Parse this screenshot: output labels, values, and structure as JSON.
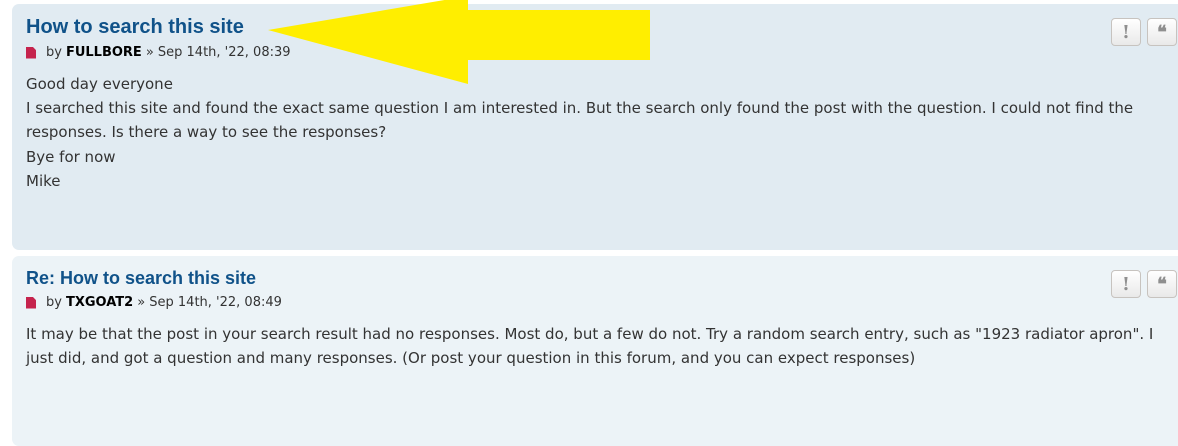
{
  "posts": [
    {
      "title": "How to search this site",
      "by": "by",
      "author": "FULLBORE",
      "date": "» Sep 14th, '22, 08:39",
      "lines": [
        "Good day everyone",
        "I searched this site and found the exact same question I am interested in. But the search only found the post with the question. I could not find the responses. Is there a way to see the responses?",
        "Bye for now",
        "Mike"
      ],
      "report_glyph": "!",
      "quote_glyph": "❝"
    },
    {
      "title": "Re: How to search this site",
      "by": "by",
      "author": "TXGOAT2",
      "date": "» Sep 14th, '22, 08:49",
      "lines": [
        "It may be that the post in your search result had no responses. Most do, but a few do not. Try a random search entry, such as \"1923 radiator apron\". I just did, and got a question and many responses. (Or post your question in this forum, and you can expect responses)"
      ],
      "report_glyph": "!",
      "quote_glyph": "❝"
    }
  ],
  "annotation": {
    "arrow_color": "#ffee00",
    "icon": "arrow-left-icon"
  },
  "colors": {
    "post1_bg": "#e1ebf2",
    "post2_bg": "#ecf3f7",
    "title": "#105289",
    "post_icon": "#c5234d"
  }
}
